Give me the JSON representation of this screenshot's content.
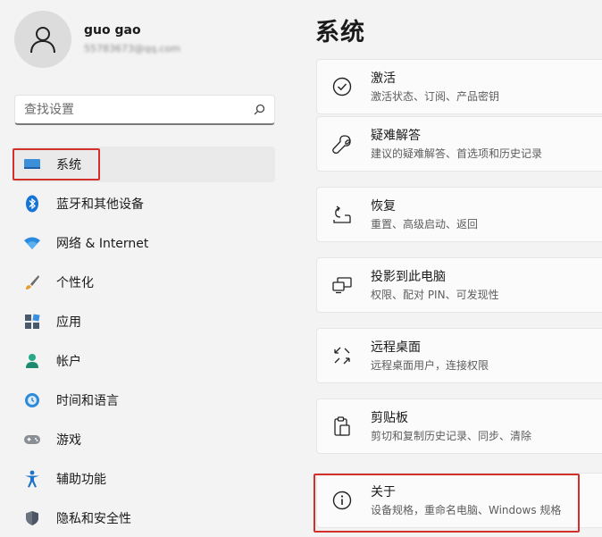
{
  "profile": {
    "name": "guo gao",
    "email": "55783673@qq.com"
  },
  "search": {
    "placeholder": "查找设置"
  },
  "nav": {
    "items": [
      {
        "label": "系统",
        "icon": "monitor-icon"
      },
      {
        "label": "蓝牙和其他设备",
        "icon": "bluetooth-icon"
      },
      {
        "label": "网络 & Internet",
        "icon": "wifi-icon"
      },
      {
        "label": "个性化",
        "icon": "brush-icon"
      },
      {
        "label": "应用",
        "icon": "apps-icon"
      },
      {
        "label": "帐户",
        "icon": "person-icon"
      },
      {
        "label": "时间和语言",
        "icon": "globe-clock-icon"
      },
      {
        "label": "游戏",
        "icon": "gamepad-icon"
      },
      {
        "label": "辅助功能",
        "icon": "accessibility-icon"
      },
      {
        "label": "隐私和安全性",
        "icon": "shield-icon"
      }
    ]
  },
  "main": {
    "title": "系统",
    "cards": [
      {
        "title": "激活",
        "subtitle": "激活状态、订阅、产品密钥",
        "icon": "check-circle-icon"
      },
      {
        "title": "疑难解答",
        "subtitle": "建议的疑难解答、首选项和历史记录",
        "icon": "wrench-icon"
      },
      {
        "title": "恢复",
        "subtitle": "重置、高级启动、返回",
        "icon": "recovery-icon"
      },
      {
        "title": "投影到此电脑",
        "subtitle": "权限、配对 PIN、可发现性",
        "icon": "projection-icon"
      },
      {
        "title": "远程桌面",
        "subtitle": "远程桌面用户，连接权限",
        "icon": "remote-desktop-icon"
      },
      {
        "title": "剪贴板",
        "subtitle": "剪切和复制历史记录、同步、清除",
        "icon": "clipboard-icon"
      },
      {
        "title": "关于",
        "subtitle": "设备规格，重命名电脑、Windows 规格",
        "icon": "info-icon"
      }
    ]
  },
  "colors": {
    "accent": "#0067c0",
    "highlight": "#d4302b"
  }
}
